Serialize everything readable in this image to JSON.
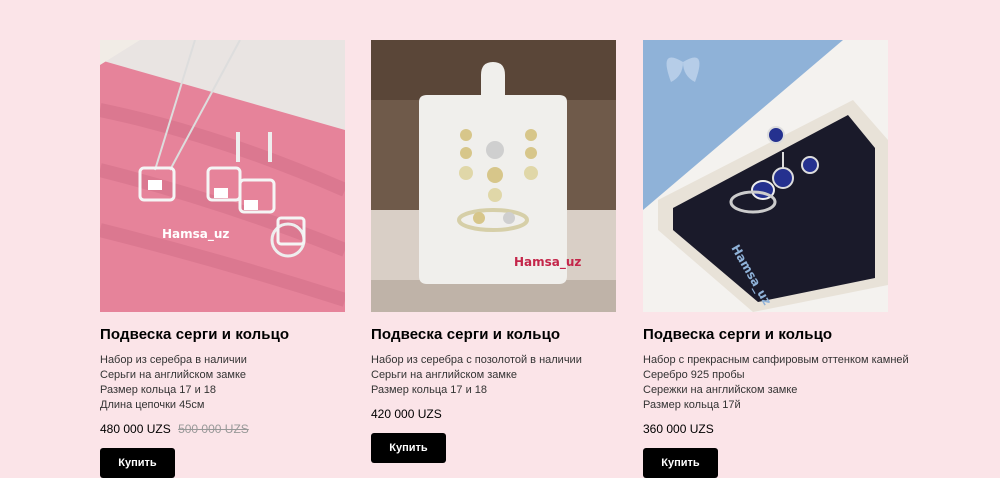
{
  "products": [
    {
      "title": "Подвеска серги и кольцо",
      "description": [
        "Набор из серебра в наличии",
        "Серьги на английском замке",
        "Размер кольца 17 и 18",
        "Длина цепочки 45см"
      ],
      "price": "480 000 UZS",
      "old_price": "500 000 UZS",
      "buy_label": "Купить",
      "watermark": "Hamsa_uz"
    },
    {
      "title": "Подвеска серги и кольцо",
      "description": [
        "Набор из серебра с позолотой в наличии",
        "Серьги на английском замке",
        "Размер кольца 17 и 18"
      ],
      "price": "420 000 UZS",
      "buy_label": "Купить",
      "watermark": "Hamsa_uz"
    },
    {
      "title": "Подвеска серги и кольцо",
      "description": [
        "Набор с прекрасным сапфировым оттенком камней",
        "Серебро 925 пробы",
        "Сережки на английском замке",
        "Размер кольца 17й"
      ],
      "price": "360 000 UZS",
      "buy_label": "Купить",
      "watermark": "Hamsa_uz"
    }
  ],
  "colors": {
    "page_background": "#fbe4e8",
    "button_background": "#000000",
    "button_text": "#ffffff",
    "old_price": "#999999"
  }
}
